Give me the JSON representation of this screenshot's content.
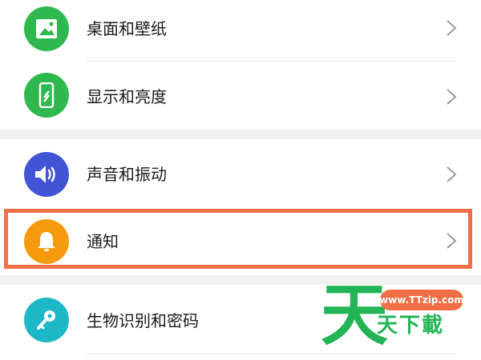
{
  "settings": {
    "items": [
      {
        "label": "桌面和壁纸",
        "icon": "image-icon",
        "color": "#2fb84e"
      },
      {
        "label": "显示和亮度",
        "icon": "phone-brightness-icon",
        "color": "#2fb84e"
      },
      {
        "label": "声音和振动",
        "icon": "speaker-icon",
        "color": "#4154d6"
      },
      {
        "label": "通知",
        "icon": "bell-icon",
        "color": "#f59a0c"
      },
      {
        "label": "生物识别和密码",
        "icon": "key-icon",
        "color": "#1db7c7"
      }
    ],
    "highlight_color": "#ef6e44",
    "separator_color": "#f1f1f1"
  },
  "watermark": {
    "big_char": "天",
    "url": "www.TTzip.com",
    "text": "天下載",
    "color": "#22b455"
  }
}
